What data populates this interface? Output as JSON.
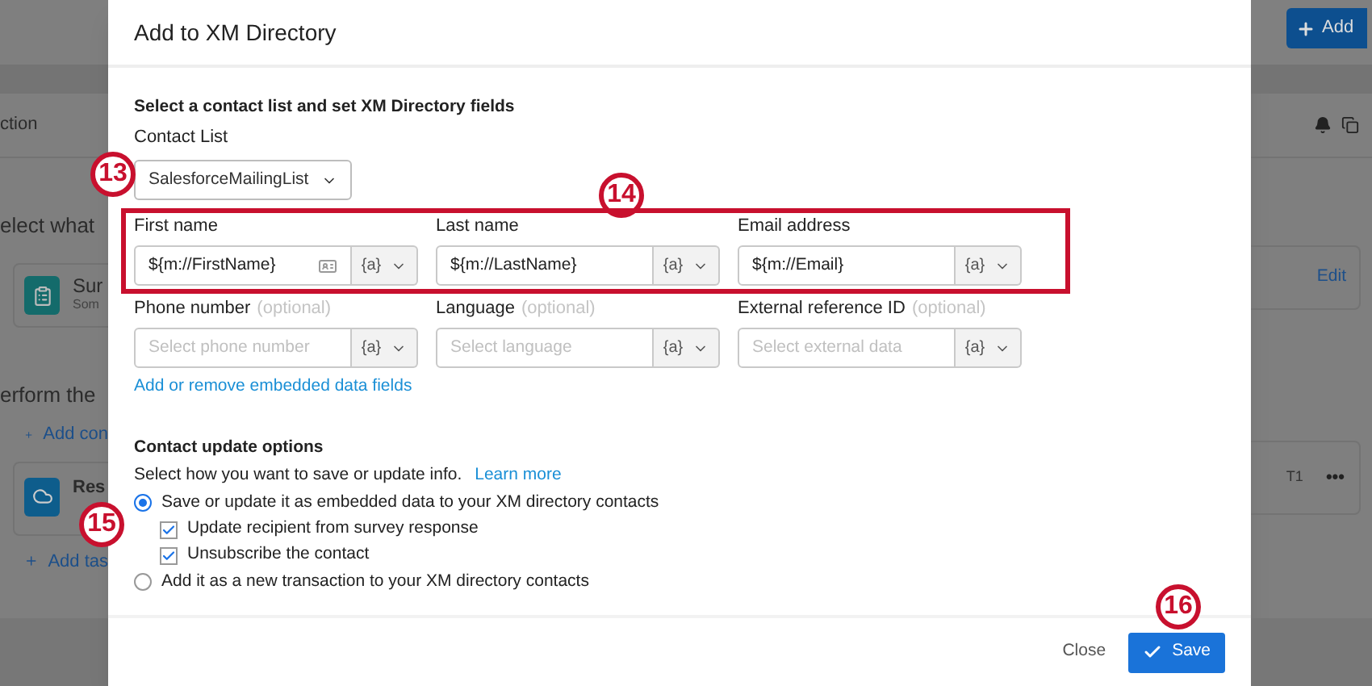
{
  "background_page": {
    "left": {
      "column_header": "ction",
      "heading_1": "elect what",
      "survey_card": {
        "title": "Sur",
        "subtitle": "Som"
      },
      "heading_2": "erform the",
      "add_link_1": "Add con",
      "task_card": {
        "title": "Res"
      },
      "add_link_2": "Add tas"
    },
    "right": {
      "add_button": "Add",
      "survey_card_action": "Edit",
      "task_card": {
        "tag": "T1",
        "menu": "•••"
      }
    }
  },
  "dialog": {
    "title": "Add to XM Directory",
    "section_heading": "Select a contact list and set XM Directory fields",
    "contact_list": {
      "label": "Contact List",
      "value": "SalesforceMailingList"
    },
    "fields": [
      {
        "label": "First name",
        "value": "${m://FirstName}",
        "details_icon": true,
        "addon": "{a}"
      },
      {
        "label": "Last name",
        "value": "${m://LastName}",
        "details_icon": false,
        "addon": "{a}"
      },
      {
        "label": "Email address",
        "value": "${m://Email}",
        "details_icon": false,
        "addon": "{a}"
      },
      {
        "label": "Phone number",
        "optional": "(optional)",
        "placeholder": "Select phone number",
        "details_icon": false,
        "addon": "{a}"
      },
      {
        "label": "Language",
        "optional": "(optional)",
        "placeholder": "Select language",
        "details_icon": false,
        "addon": "{a}"
      },
      {
        "label": "External reference ID",
        "optional": "(optional)",
        "placeholder": "Select external data",
        "details_icon": false,
        "addon": "{a}"
      }
    ],
    "embedded_link": "Add or remove embedded data fields",
    "update_options": {
      "heading": "Contact update options",
      "description": "Select how you want to save or update info.",
      "learn_more": "Learn more",
      "options": [
        {
          "label": "Save or update it as embedded data to your XM directory contacts",
          "selected": true,
          "children": [
            {
              "label": "Update recipient from survey response",
              "checked": true
            },
            {
              "label": "Unsubscribe the contact",
              "checked": true
            }
          ]
        },
        {
          "label": "Add it as a new transaction to your XM directory contacts",
          "selected": false
        }
      ]
    },
    "footer": {
      "close": "Close",
      "save": "Save"
    }
  },
  "annotations": [
    {
      "kind": "callout",
      "label": "13"
    },
    {
      "kind": "callout",
      "label": "14"
    },
    {
      "kind": "callout",
      "label": "15"
    },
    {
      "kind": "callout",
      "label": "16"
    },
    {
      "kind": "frame"
    }
  ]
}
